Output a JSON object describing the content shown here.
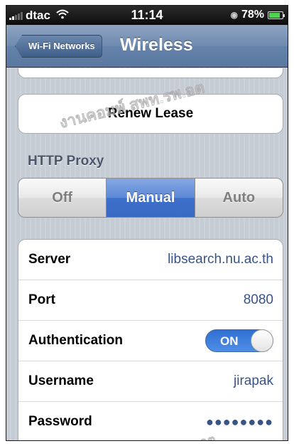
{
  "status_bar": {
    "carrier": "dtac",
    "time": "11:14",
    "battery_percent": "78%",
    "icons": [
      "signal-icon",
      "wifi-icon",
      "lock-icon",
      "battery-icon"
    ]
  },
  "nav": {
    "back_label": "Wi-Fi Networks",
    "title": "Wireless"
  },
  "renew_lease_label": "Renew Lease",
  "http_proxy": {
    "header": "HTTP Proxy",
    "options": [
      "Off",
      "Manual",
      "Auto"
    ],
    "selected": "Manual"
  },
  "proxy_settings": {
    "server": {
      "label": "Server",
      "value": "libsearch.nu.ac.th"
    },
    "port": {
      "label": "Port",
      "value": "8080"
    },
    "authentication": {
      "label": "Authentication",
      "toggle": "ON"
    },
    "username": {
      "label": "Username",
      "value": "jirapak"
    },
    "password": {
      "label": "Password",
      "value": "●●●●●●●●"
    }
  },
  "watermark": {
    "top": "งานคอมพ์ สพท.รพ.อต",
    "bottom": "รพ.อต"
  },
  "colors": {
    "nav_blue": "#6f8bb0",
    "selected_segment": "#3c6fcb",
    "value_text": "#385487",
    "section_header": "#4c566c",
    "toggle_on": "#2f6fd1"
  }
}
